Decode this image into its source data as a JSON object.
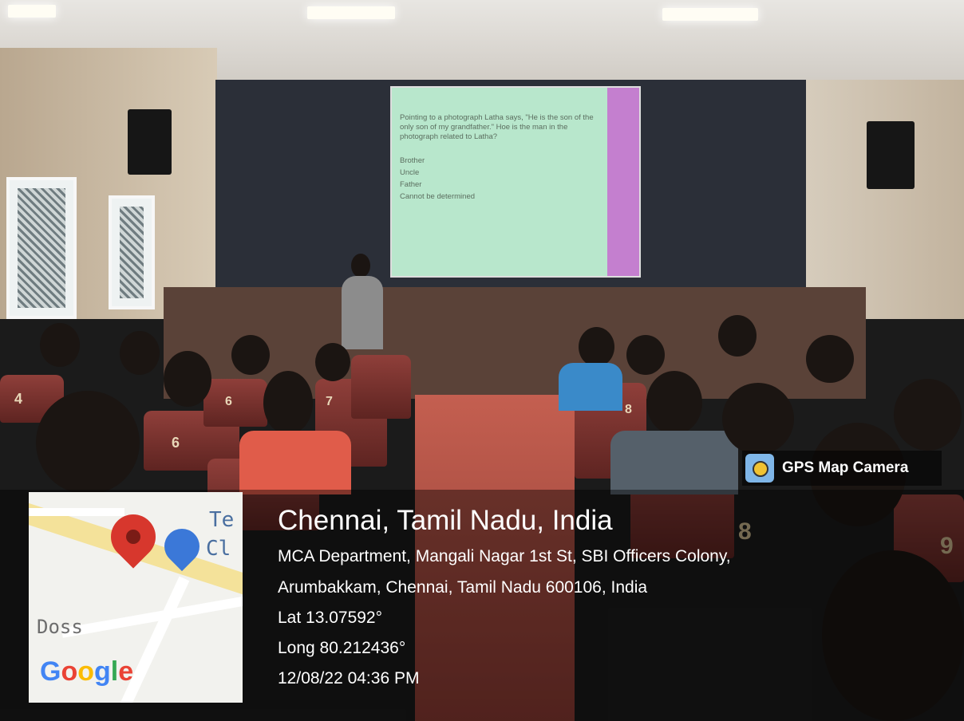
{
  "slide": {
    "question": "Pointing to a photograph Latha says, \"He is the son of the only son of my grandfather.\" Hoe is the man in the photograph related to Latha?",
    "options": [
      "Brother",
      "Uncle",
      "Father",
      "Cannot be determined"
    ]
  },
  "gps": {
    "badge_label": "GPS Map Camera",
    "location_title": "Chennai, Tamil Nadu, India",
    "address_line1": "MCA Department, Mangali Nagar 1st St, SBI Officers Colony,",
    "address_line2": "Arumbakkam, Chennai, Tamil Nadu 600106, India",
    "lat": "Lat 13.07592°",
    "long": "Long 80.212436°",
    "datetime": "12/08/22 04:36 PM"
  },
  "map": {
    "label_te": "Te",
    "label_cl": "Cl",
    "label_doss": "Doss",
    "google": [
      "G",
      "o",
      "o",
      "g",
      "l",
      "e"
    ],
    "google_colors": [
      "#4285F4",
      "#EA4335",
      "#FBBC05",
      "#4285F4",
      "#34A853",
      "#EA4335"
    ]
  },
  "seat_numbers": [
    "4",
    "6",
    "6",
    "7",
    "8",
    "8",
    "9"
  ]
}
